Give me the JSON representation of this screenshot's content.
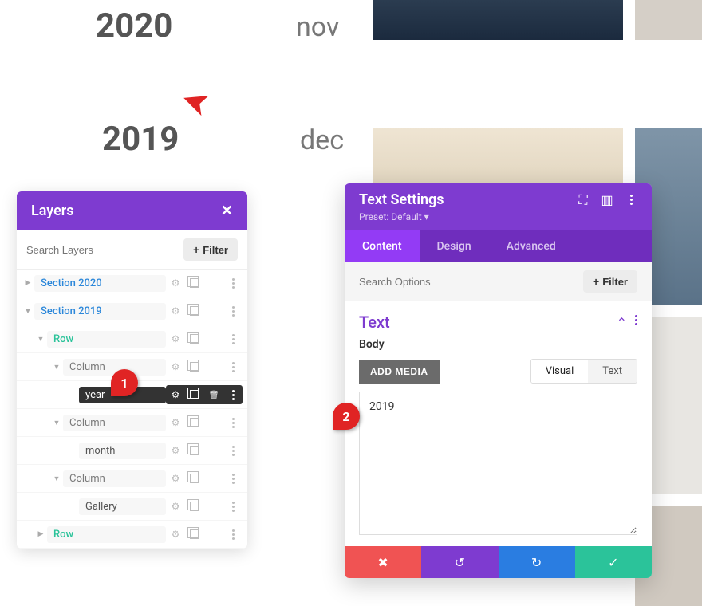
{
  "background": {
    "year_2020": "2020",
    "year_2019": "2019",
    "month_nov": "nov",
    "month_dec": "dec"
  },
  "arrow_target": "2019",
  "badges": {
    "one": "1",
    "two": "2"
  },
  "layers": {
    "title": "Layers",
    "search_placeholder": "Search Layers",
    "filter_label": "Filter",
    "items": [
      {
        "label": "Section 2020",
        "type": "section",
        "indent": 0,
        "arrow": "▶",
        "selected": false
      },
      {
        "label": "Section 2019",
        "type": "section",
        "indent": 0,
        "arrow": "▼",
        "selected": false
      },
      {
        "label": "Row",
        "type": "row",
        "indent": 1,
        "arrow": "▼",
        "selected": false
      },
      {
        "label": "Column",
        "type": "column",
        "indent": 2,
        "arrow": "▼",
        "selected": false
      },
      {
        "label": "year",
        "type": "module",
        "indent": 3,
        "arrow": "",
        "selected": true
      },
      {
        "label": "Column",
        "type": "column",
        "indent": 2,
        "arrow": "▼",
        "selected": false
      },
      {
        "label": "month",
        "type": "module",
        "indent": 3,
        "arrow": "",
        "selected": false
      },
      {
        "label": "Column",
        "type": "column",
        "indent": 2,
        "arrow": "▼",
        "selected": false
      },
      {
        "label": "Gallery",
        "type": "module",
        "indent": 3,
        "arrow": "",
        "selected": false
      },
      {
        "label": "Row",
        "type": "row",
        "indent": 1,
        "arrow": "▶",
        "selected": false
      }
    ]
  },
  "settings": {
    "title": "Text Settings",
    "preset": "Preset: Default",
    "tabs": {
      "content": "Content",
      "design": "Design",
      "advanced": "Advanced"
    },
    "search_placeholder": "Search Options",
    "filter_label": "Filter",
    "section": {
      "title": "Text"
    },
    "body_label": "Body",
    "add_media": "ADD MEDIA",
    "editor_tabs": {
      "visual": "Visual",
      "text": "Text"
    },
    "editor_content": "2019"
  }
}
